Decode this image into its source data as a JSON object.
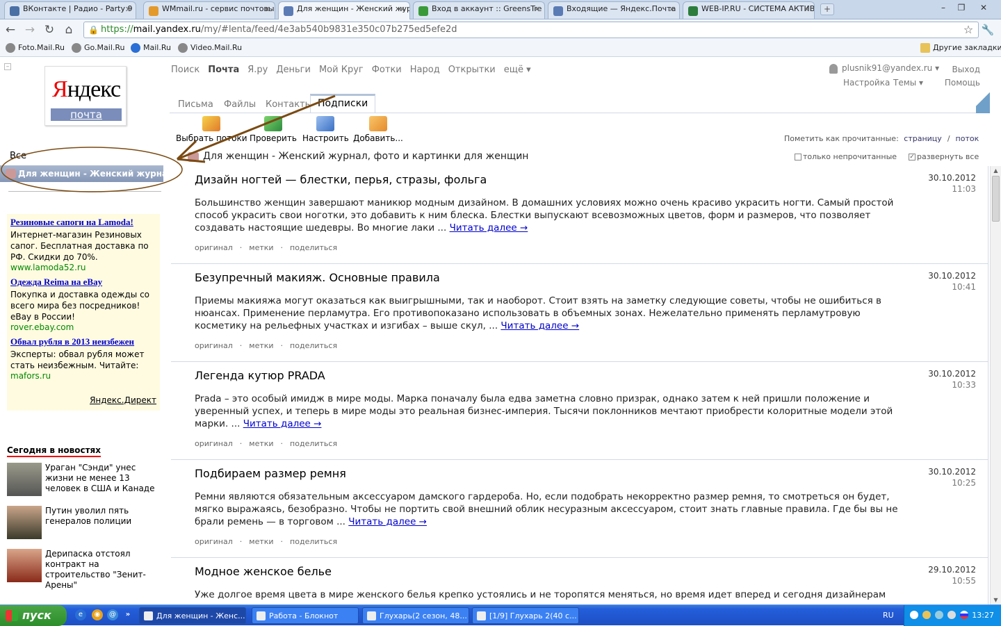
{
  "browser": {
    "tabs": [
      {
        "title": "ВКонтакте | Радио - Party 9",
        "active": false,
        "icon": "vk-music-icon",
        "color": "#4a6fa5"
      },
      {
        "title": "WMmail.ru - сервис почтовых",
        "active": false,
        "icon": "wmmail-icon",
        "color": "#e49a2b"
      },
      {
        "title": "Для женщин - Женский журн",
        "active": true,
        "icon": "mail-icon",
        "color": "#5b7bb5"
      },
      {
        "title": "Вход в аккаунт :: GreensTre",
        "active": false,
        "icon": "tree-icon",
        "color": "#3a9a3a"
      },
      {
        "title": "Входящие — Яндекс.Почта",
        "active": false,
        "icon": "mail-icon",
        "color": "#5b7bb5"
      },
      {
        "title": "WEB-IP.RU - СИСТЕМА АКТИВ",
        "active": false,
        "icon": "web-ip-icon",
        "color": "#2c7d3c"
      }
    ],
    "url": {
      "scheme": "https://",
      "host": "mail.yandex.ru",
      "path": "/my/#lenta/feed/4e3ab540b9831e350c07b275ed5efe2d"
    },
    "bookmarks": [
      "Foto.Mail.Ru",
      "Go.Mail.Ru",
      "Mail.Ru",
      "Video.Mail.Ru"
    ],
    "other_bookmarks": "Другие закладки"
  },
  "logo": {
    "text_red": "Я",
    "text_rest": "ндекс",
    "service": "почта"
  },
  "sidebar": {
    "all_label": "Все",
    "selected_feed": "Для женщин - Женский журнал"
  },
  "ads": [
    {
      "title": "Резиновые сапоги на Lamoda!",
      "text": "Интернет-магазин Резиновых сапог. Бесплатная доставка по РФ. Скидки до 70%.",
      "url": "www.lamoda52.ru"
    },
    {
      "title": "Одежда Reima на eBay",
      "text": "Покупка и доставка одежды со всего мира без посредников! eBay в России!",
      "url": "rover.ebay.com"
    },
    {
      "title": "Обвал рубля в 2013 неизбежен",
      "text": "Эксперты: обвал рубля может стать неизбежным. Читайте:",
      "url": "mafors.ru"
    }
  ],
  "ads_source": "Яндекс.Директ",
  "news": {
    "heading": "Сегодня в новостях",
    "items": [
      {
        "text": "Ураган \"Сэнди\" унес жизни не менее 13 человек в США и Канаде"
      },
      {
        "text": "Путин уволил пять генералов полиции"
      },
      {
        "text": "Дерипаска отстоял контракт на строительство \"Зенит-Арены\""
      }
    ]
  },
  "topnav": {
    "items": [
      "Поиск",
      "Почта",
      "Я.ру",
      "Деньги",
      "Мой Круг",
      "Фотки",
      "Народ",
      "Открытки",
      "ещё ▾"
    ],
    "current": "Почта"
  },
  "user": {
    "email": "plusnik91@yandex.ru ▾",
    "exit": "Выход",
    "settings": "Настройка",
    "themes": "Темы ▾",
    "help": "Помощь"
  },
  "subtabs": {
    "items": [
      "Письма",
      "Файлы",
      "Контакты",
      "Подписки"
    ],
    "active": "Подписки"
  },
  "actions": [
    {
      "label": "Выбрать потоки",
      "icon": "pencil-icon",
      "color": "#e8a33a"
    },
    {
      "label": "Проверить",
      "icon": "refresh-icon",
      "color": "#4caf50"
    },
    {
      "label": "Настроить",
      "icon": "gear-icon",
      "color": "#5a8fd6"
    },
    {
      "label": "Добавить...",
      "icon": "add-icon",
      "color": "#e8a33a"
    }
  ],
  "mark_read": {
    "label": "Пометить как прочитанные:",
    "page": "страницу",
    "sep": "/",
    "stream": "поток"
  },
  "feed": {
    "title": "Для женщин - Женский журнал, фото и картинки для женщин",
    "unread_only": "только непрочитанные",
    "expand_all": "развернуть все"
  },
  "post_meta": {
    "original": "оригинал",
    "tags": "метки",
    "share": "поделиться",
    "sep": "·"
  },
  "read_more": "Читать далее →",
  "posts": [
    {
      "title": "Дизайн ногтей — блестки, перья, стразы, фольга",
      "date": "30.10.2012",
      "time": "11:03",
      "body": "Большинство женщин завершают маникюр модным дизайном. В домашних условиях можно очень красиво украсить ногти. Самый простой способ украсить свои ноготки, это добавить к ним блеска. Блестки выпускают всевозможных цветов, форм и размеров, что позволяет создавать настоящие шедевры. Во многие лаки ..."
    },
    {
      "title": "Безупречный макияж. Основные правила",
      "date": "30.10.2012",
      "time": "10:41",
      "body": "Приемы макияжа могут оказаться как выигрышными, так и наоборот. Стоит взять на заметку следующие советы, чтобы не ошибиться в нюансах. Применение перламутра. Его противопоказано использовать в объемных зонах. Нежелательно применять перламутровую косметику на рельефных участках и изгибах – выше скул, ..."
    },
    {
      "title": "Легенда кутюр PRADA",
      "date": "30.10.2012",
      "time": "10:33",
      "body": "Prada – это особый имидж в мире моды. Марка поначалу была едва заметна словно призрак, однако затем к ней пришли положение и уверенный успех, и теперь в мире моды это реальная бизнес-империя. Тысячи поклонников мечтают приобрести колоритные модели этой марки. ..."
    },
    {
      "title": "Подбираем размер ремня",
      "date": "30.10.2012",
      "time": "10:25",
      "body": "Ремни являются обязательным аксессуаром дамского гардероба. Но, если подобрать некорректно размер ремня, то  смотреться он будет, мягко выражаясь, безобразно. Чтобы не портить свой внешний облик несуразным аксессуаром, стоит знать главные правила. Где бы  вы не брали ремень — в торговом ..."
    },
    {
      "title": "Модное женское белье",
      "date": "29.10.2012",
      "time": "10:55",
      "body": "Уже долгое время цвета в мире женского белья крепко устоялись и не торопятся меняться, но время идет вперед и сегодня дизайнерам приходят в"
    }
  ],
  "taskbar": {
    "start": "пуск",
    "tasks": [
      {
        "label": "Для женщин - Женс...",
        "active": true
      },
      {
        "label": "Работа - Блокнот",
        "active": false
      },
      {
        "label": "Глухарь(2 сезон, 48...",
        "active": false
      },
      {
        "label": "[1/9] Глухарь 2(40 с...",
        "active": false
      }
    ],
    "lang": "RU",
    "clock": "13:27"
  }
}
